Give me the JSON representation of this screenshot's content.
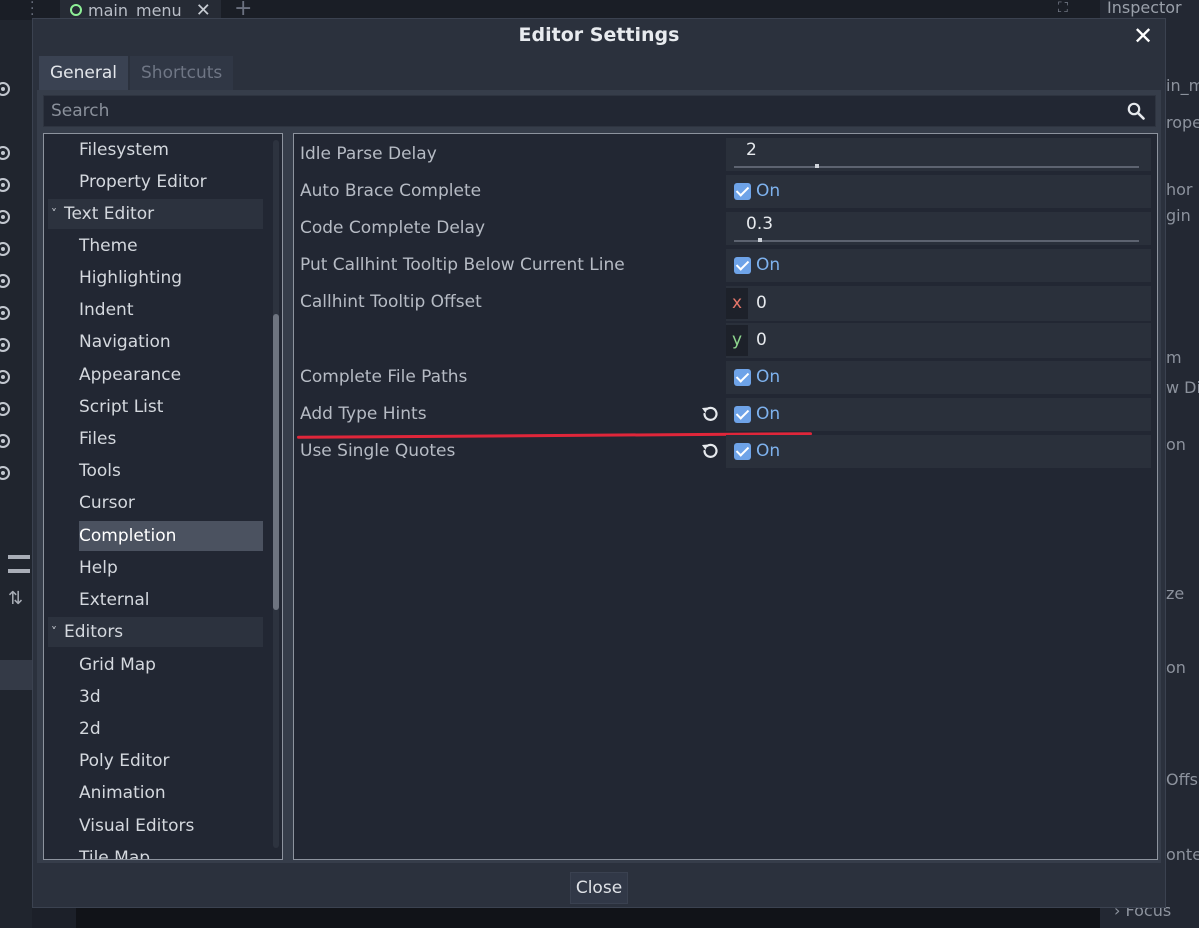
{
  "background": {
    "scene_tab": "main_menu",
    "inspector_title": "Inspector",
    "inspector_fragments": [
      "in_m",
      "rope",
      "hor",
      "gin",
      "m",
      "w Dir",
      "on",
      "ze",
      "on",
      "Offs",
      "onte",
      "Focus"
    ]
  },
  "dialog": {
    "title": "Editor Settings",
    "tabs": [
      "General",
      "Shortcuts"
    ],
    "search_placeholder": "Search",
    "close_label": "Close",
    "tree": [
      {
        "label": "Filesystem"
      },
      {
        "label": "Property Editor"
      },
      {
        "label": "Text Editor",
        "group": true
      },
      {
        "label": "Theme"
      },
      {
        "label": "Highlighting"
      },
      {
        "label": "Indent"
      },
      {
        "label": "Navigation"
      },
      {
        "label": "Appearance"
      },
      {
        "label": "Script List"
      },
      {
        "label": "Files"
      },
      {
        "label": "Tools"
      },
      {
        "label": "Cursor"
      },
      {
        "label": "Completion",
        "selected": true
      },
      {
        "label": "Help"
      },
      {
        "label": "External"
      },
      {
        "label": "Editors",
        "group": true
      },
      {
        "label": "Grid Map"
      },
      {
        "label": "3d"
      },
      {
        "label": "2d"
      },
      {
        "label": "Poly Editor"
      },
      {
        "label": "Animation"
      },
      {
        "label": "Visual Editors"
      },
      {
        "label": "Tile Map"
      }
    ],
    "properties": {
      "idle_parse_delay": {
        "label": "Idle Parse Delay",
        "value": "2",
        "slider_fraction": 0.2
      },
      "auto_brace_complete": {
        "label": "Auto Brace Complete",
        "state": "On"
      },
      "code_complete_delay": {
        "label": "Code Complete Delay",
        "value": "0.3",
        "slider_fraction": 0.06
      },
      "put_callhint_below": {
        "label": "Put Callhint Tooltip Below Current Line",
        "state": "On"
      },
      "callhint_offset": {
        "label": "Callhint Tooltip Offset",
        "x_axis": "x",
        "x": "0",
        "y_axis": "y",
        "y": "0"
      },
      "complete_file_paths": {
        "label": "Complete File Paths",
        "state": "On"
      },
      "add_type_hints": {
        "label": "Add Type Hints",
        "state": "On"
      },
      "use_single_quotes": {
        "label": "Use Single Quotes",
        "state": "On"
      }
    }
  },
  "colors": {
    "checkbox": "#6ea3e8",
    "on_text": "#7eb2ee",
    "axis_x": "#e5766a",
    "axis_y": "#8ed68e",
    "annotation": "#e0263a"
  }
}
